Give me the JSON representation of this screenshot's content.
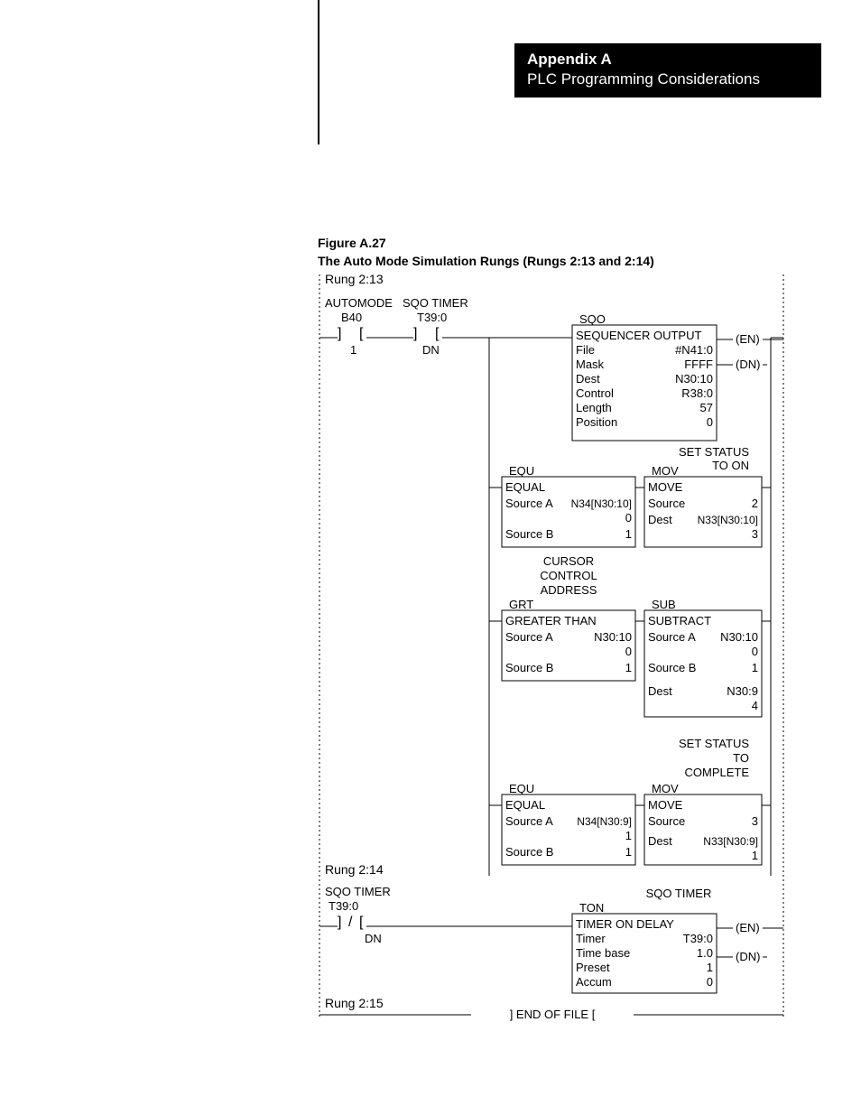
{
  "header": {
    "appendix_title": "Appendix A",
    "appendix_subtitle": "PLC Programming Considerations"
  },
  "figure": {
    "label": "Figure A.27",
    "caption": "The Auto Mode Simulation Rungs (Rungs 2:13 and 2:14)"
  },
  "rung_213": {
    "label": "Rung 2:13",
    "contact1": {
      "title": "AUTOMODE",
      "addr": "B40",
      "status": "1"
    },
    "contact2": {
      "title": "SQO TIMER",
      "addr": "T39:0",
      "status": "DN"
    },
    "sqo": {
      "mnemonic": "SQO",
      "title": "SEQUENCER OUTPUT",
      "rows": [
        [
          "File",
          "#N41:0"
        ],
        [
          "Mask",
          "FFFF"
        ],
        [
          "Dest",
          "N30:10"
        ],
        [
          "Control",
          "R38:0"
        ],
        [
          "Length",
          "57"
        ],
        [
          "Position",
          "0"
        ]
      ],
      "outs": [
        "(EN)",
        "(DN)"
      ]
    },
    "branch1": {
      "note": [
        "SET STATUS",
        "TO ON"
      ],
      "equ": {
        "mnemonic": "EQU",
        "title": "EQUAL",
        "rows": [
          [
            "Source A",
            "N34[N30:10]"
          ],
          [
            "",
            "0"
          ],
          [
            "Source B",
            "1"
          ]
        ]
      },
      "mov": {
        "mnemonic": "MOV",
        "title": "MOVE",
        "rows": [
          [
            "Source",
            "2"
          ],
          [
            "Dest",
            "N33[N30:10]"
          ],
          [
            "",
            "3"
          ]
        ]
      }
    },
    "branch2": {
      "note": [
        "CURSOR",
        "CONTROL",
        "ADDRESS"
      ],
      "grt": {
        "mnemonic": "GRT",
        "title": "GREATER THAN",
        "rows": [
          [
            "Source A",
            "N30:10"
          ],
          [
            "",
            "0"
          ],
          [
            "Source B",
            "1"
          ]
        ]
      },
      "sub": {
        "mnemonic": "SUB",
        "title": "SUBTRACT",
        "rows": [
          [
            "Source A",
            "N30:10"
          ],
          [
            "",
            "0"
          ],
          [
            "Source B",
            "1"
          ],
          [
            "Dest",
            "N30:9"
          ],
          [
            "",
            "4"
          ]
        ]
      }
    },
    "branch3": {
      "note": [
        "SET STATUS",
        "TO",
        "COMPLETE"
      ],
      "equ": {
        "mnemonic": "EQU",
        "title": "EQUAL",
        "rows": [
          [
            "Source A",
            "N34[N30:9]"
          ],
          [
            "",
            "1"
          ],
          [
            "Source B",
            "1"
          ]
        ]
      },
      "mov": {
        "mnemonic": "MOV",
        "title": "MOVE",
        "rows": [
          [
            "Source",
            "3"
          ],
          [
            "Dest",
            "N33[N30:9]"
          ],
          [
            "",
            "1"
          ]
        ]
      }
    }
  },
  "rung_214": {
    "label": "Rung 2:14",
    "contact": {
      "title": "SQO TIMER",
      "addr": "T39:0",
      "status": "DN"
    },
    "ton": {
      "note": "SQO TIMER",
      "mnemonic": "TON",
      "title": "TIMER ON DELAY",
      "rows": [
        [
          "Timer",
          "T39:0"
        ],
        [
          "Time base",
          "1.0"
        ],
        [
          "Preset",
          "1"
        ],
        [
          "Accum",
          "0"
        ]
      ],
      "outs": [
        "(EN)",
        "(DN)"
      ]
    }
  },
  "rung_215": {
    "label": "Rung 2:15",
    "eof": "] END OF FILE ["
  }
}
